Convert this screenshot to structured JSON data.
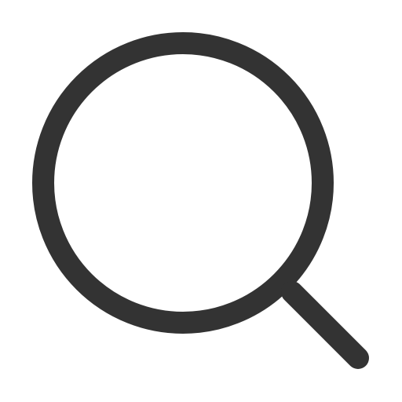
{
  "icon": {
    "name": "search-icon",
    "stroke_color": "#333333",
    "background": "#ffffff"
  }
}
